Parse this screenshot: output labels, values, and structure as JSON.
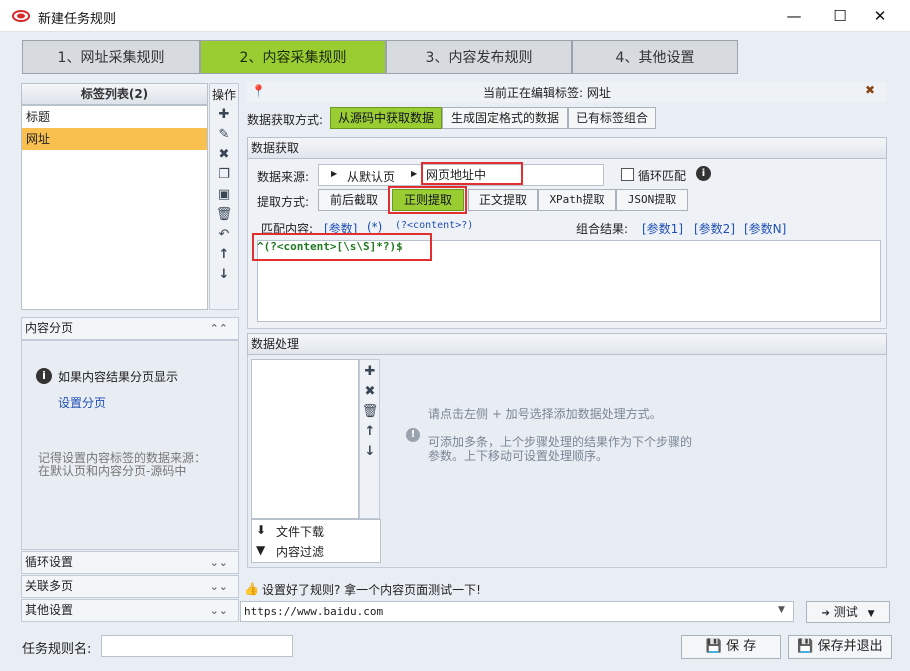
{
  "window": {
    "title": "新建任务规则",
    "minimize": "—",
    "maximize": "☐",
    "close": "✕"
  },
  "steps": [
    "1、网址采集规则",
    "2、内容采集规则",
    "3、内容发布规则",
    "4、其他设置"
  ],
  "tags": {
    "title": "标签列表(2)",
    "items": [
      "标题",
      "网址"
    ],
    "ops_label": "操作"
  },
  "paging": {
    "title": "内容分页",
    "info": "如果内容结果分页显示",
    "link": "设置分页",
    "hint_line1": "记得设置内容标签的数据来源：",
    "hint_line2": "在默认页和内容分页-源码中"
  },
  "collapsed": [
    "循环设置",
    "关联多页",
    "其他设置"
  ],
  "editing": {
    "label": "当前正在编辑标签: 网址"
  },
  "method": {
    "label": "数据获取方式:",
    "options": [
      "从源码中获取数据",
      "生成固定格式的数据",
      "已有标签组合"
    ]
  },
  "fetch": {
    "section": "数据获取",
    "source_label": "数据来源:",
    "source_default": "从默认页",
    "source_current": "网页地址中",
    "loop_label": "循环匹配",
    "extract_label": "提取方式:",
    "extract_options": [
      "前后截取",
      "正则提取",
      "正文提取",
      "XPath提取",
      "JSON提取"
    ],
    "match_label": "匹配内容:",
    "match_tokens": [
      "[参数]",
      "(*)",
      "(?<content>?)"
    ],
    "combine_label": "组合结果:",
    "combine_tokens": [
      "[参数1]",
      "[参数2]",
      "[参数N]"
    ],
    "regex": "^(?<content>[\\s\\S]*?)$"
  },
  "processing": {
    "section": "数据处理",
    "items": [
      "文件下载",
      "内容过滤"
    ],
    "hint1": "请点击左侧 + 加号选择添加数据处理方式。",
    "hint2_line1": "可添加多条，上个步骤处理的结果作为下个步骤的",
    "hint2_line2": "参数。上下移动可设置处理顺序。"
  },
  "test": {
    "prompt": "设置好了规则? 拿一个内容页面测试一下!",
    "url": "https://www.baidu.com",
    "button": "测试"
  },
  "footer": {
    "name_label": "任务规则名:",
    "name_value": "",
    "save": "保 存",
    "save_exit": "保存并退出"
  },
  "colors": {
    "accent": "#9acd32",
    "highlight": "#f9c04f",
    "annotation": "#e23030",
    "link": "#1f4fb4"
  }
}
